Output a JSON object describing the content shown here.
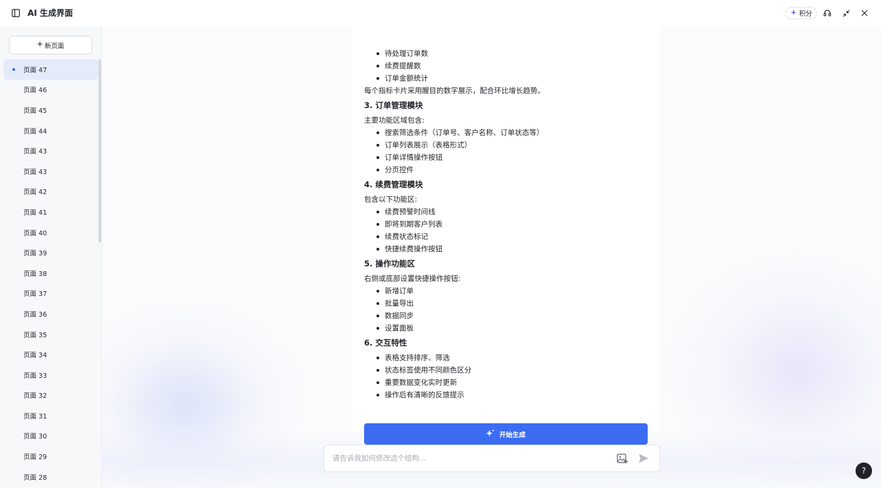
{
  "header": {
    "title": "AI 生成界面",
    "points_label": "积分"
  },
  "sidebar": {
    "new_page_label": "新页面",
    "pages": [
      {
        "label": "页面 47",
        "active": true
      },
      {
        "label": "页面 46"
      },
      {
        "label": "页面 45"
      },
      {
        "label": "页面 44"
      },
      {
        "label": "页面 43"
      },
      {
        "label": "页面 43"
      },
      {
        "label": "页面 42"
      },
      {
        "label": "页面 41"
      },
      {
        "label": "页面 40"
      },
      {
        "label": "页面 39"
      },
      {
        "label": "页面 38"
      },
      {
        "label": "页面 37"
      },
      {
        "label": "页面 36"
      },
      {
        "label": "页面 35"
      },
      {
        "label": "页面 34"
      },
      {
        "label": "页面 33"
      },
      {
        "label": "页面 32"
      },
      {
        "label": "页面 31"
      },
      {
        "label": "页面 30"
      },
      {
        "label": "页面 29"
      },
      {
        "label": "页面 28"
      }
    ]
  },
  "content": {
    "top_bullets": [
      "待处理订单数",
      "续费提醒数",
      "订单金额统计"
    ],
    "top_note": "每个指标卡片采用醒目的数字展示，配合环比增长趋势。",
    "sections": [
      {
        "heading": "3. 订单管理模块",
        "intro": "主要功能区域包含:",
        "items": [
          "搜索筛选条件（订单号、客户名称、订单状态等）",
          "订单列表展示（表格形式）",
          "订单详情操作按钮",
          "分页控件"
        ]
      },
      {
        "heading": "4. 续费管理模块",
        "intro": "包含以下功能区:",
        "items": [
          "续费预警时间线",
          "即将到期客户列表",
          "续费状态标记",
          "快捷续费操作按钮"
        ]
      },
      {
        "heading": "5. 操作功能区",
        "intro": "右侧或底部设置快捷操作按钮:",
        "items": [
          "新增订单",
          "批量导出",
          "数据同步",
          "设置面板"
        ]
      },
      {
        "heading": "6. 交互特性",
        "intro": "",
        "items": [
          "表格支持排序、筛选",
          "状态标签使用不同颜色区分",
          "重要数据变化实时更新",
          "操作后有清晰的反馈提示"
        ]
      }
    ],
    "generate_label": "开始生成"
  },
  "composer": {
    "placeholder": "请告诉我如何修改这个结构...",
    "value": ""
  },
  "help_label": "?",
  "colors": {
    "accent": "#3b6cf2",
    "active_item_bg": "#e5ebfb",
    "sidebar_bg": "#f7f8fa",
    "text": "#1f2329"
  },
  "icons": {
    "sidebar_toggle": "sidebar-toggle-icon",
    "points": "sparkle-icon",
    "support": "headset-icon",
    "collapse": "collapse-arrows-icon",
    "close": "close-icon",
    "new_page": "plus-icon",
    "generate": "sparkle-icon",
    "image_upload": "image-add-icon",
    "send": "send-icon"
  }
}
